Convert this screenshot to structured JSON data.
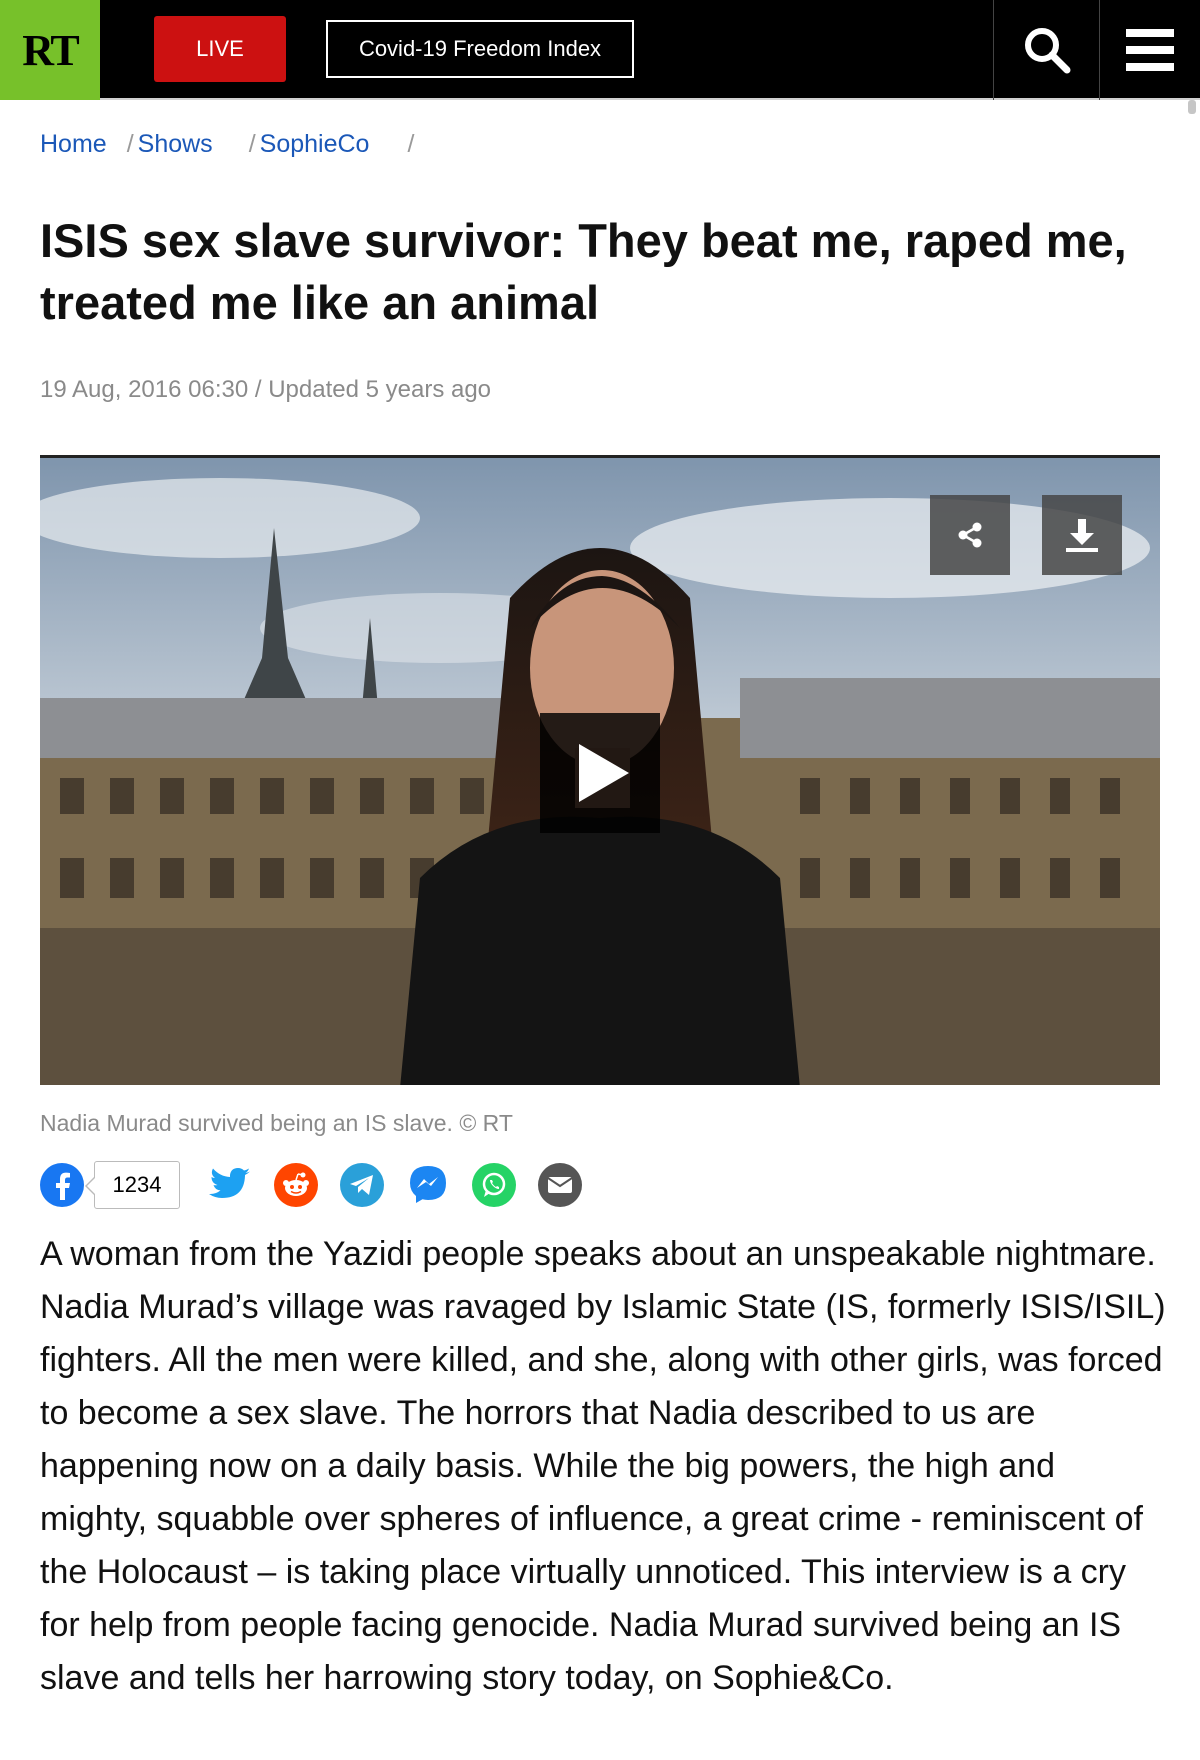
{
  "header": {
    "logo_text": "RT",
    "live_label": "LIVE",
    "covid_label": "Covid-19 Freedom Index",
    "colors": {
      "brand_green": "#77c12a",
      "live_red": "#cc1111"
    }
  },
  "breadcrumb": {
    "items": [
      {
        "label": "Home"
      },
      {
        "label": "Shows"
      },
      {
        "label": "SophieCo"
      }
    ]
  },
  "article": {
    "title": "ISIS sex slave survivor: They beat me, raped me, treated me like an animal",
    "date": "19 Aug, 2016 06:30",
    "updated": "/ Updated 5 years ago",
    "caption": "Nadia Murad survived being an IS slave. © RT",
    "body": "A woman from the Yazidi people speaks about an unspeakable nightmare. Nadia Murad’s village was ravaged by Islamic State (IS, formerly ISIS/ISIL) fighters. All the men were killed, and she, along with other girls, was forced to become a sex slave. The horrors that Nadia described to us are happening now on a daily basis. While the big powers, the high and mighty, squabble over spheres of influence, a great crime - reminiscent of the Holocaust – is taking place virtually unnoticed. This interview is a cry for help from people facing genocide. Nadia Murad survived being an IS slave and tells her harrowing story today, on Sophie&Co."
  },
  "video": {
    "icons": [
      "share-icon",
      "download-icon",
      "play-icon"
    ]
  },
  "social": {
    "facebook_count": "1234",
    "icons": [
      {
        "name": "facebook-icon",
        "color": "#1877f2"
      },
      {
        "name": "twitter-icon",
        "color": "#1da1f2"
      },
      {
        "name": "reddit-icon",
        "color": "#ff4500"
      },
      {
        "name": "telegram-icon",
        "color": "#2aa0d9"
      },
      {
        "name": "messenger-icon",
        "color": "#1c86f2"
      },
      {
        "name": "whatsapp-icon",
        "color": "#25d366"
      },
      {
        "name": "email-icon",
        "color": "#555555"
      }
    ]
  }
}
